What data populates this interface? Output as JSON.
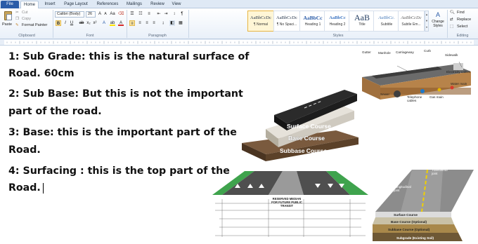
{
  "tabs": [
    "File",
    "Home",
    "Insert",
    "Page Layout",
    "References",
    "Mailings",
    "Review",
    "View"
  ],
  "clipboard": {
    "paste": "Paste",
    "cut": "Cut",
    "copy": "Copy",
    "format_painter": "Format Painter",
    "label": "Clipboard"
  },
  "font": {
    "name": "Calibri (Body)",
    "size": "26",
    "label": "Font"
  },
  "paragraph": {
    "label": "Paragraph"
  },
  "styles": {
    "items": [
      {
        "sample": "AaBbCcDc",
        "name": "¶ Normal"
      },
      {
        "sample": "AaBbCcDc",
        "name": "¶ No Spaci..."
      },
      {
        "sample": "AaBbCc",
        "name": "Heading 1"
      },
      {
        "sample": "AaBbCc",
        "name": "Heading 2"
      },
      {
        "sample": "AaB",
        "name": "Title"
      },
      {
        "sample": "AaBbCc.",
        "name": "Subtitle"
      },
      {
        "sample": "AaBbCcDc",
        "name": "Subtle Em..."
      }
    ],
    "change_styles": "Change Styles",
    "label": "Styles"
  },
  "editing": {
    "find": "Find",
    "replace": "Replace",
    "select": "Select",
    "label": "Editing"
  },
  "document": {
    "paragraphs": [
      "1: Sub Grade: this is the natural surface of",
      "Road. 60cm",
      "2: Sub Base: But this is not the important",
      "part of the road.",
      "3: Base: this is the important part of the",
      "Road.",
      "4: Surfacing : this is the top part of the",
      "Road."
    ]
  },
  "figures": {
    "street": {
      "gutter": "Gutter",
      "manhole": "Manhole",
      "carriageway": "Carriageway",
      "curb": "Curb",
      "sidewalk": "Sidewalk",
      "electricity": "Electricity cables",
      "water": "Water main",
      "sewer": "Sewer",
      "telephone": "Telephone cables",
      "gas": "Gas main"
    },
    "layers": {
      "surface": "Surface Course",
      "base": "Base Course",
      "subbase": "Subbase Course"
    },
    "cross_section": {
      "median": "RESERVED MEDIAN FOR FUTURE PUBLIC TRANSIT"
    },
    "pavement": {
      "surface": "Surface Course",
      "base": "Base Course (Optional)",
      "subbase": "Subbase Course (Optional)",
      "subgrade": "Subgrade (Existing Soil)",
      "longitudinal": "Longitudinal joint",
      "transverse": "Transverse joint"
    }
  },
  "colors": {
    "file_tab": "#2a5ca8",
    "asphalt": "#2b2b2b",
    "base_course": "#d8d3c9",
    "subbase_course": "#6a4f37",
    "grass": "#3fa34d"
  }
}
